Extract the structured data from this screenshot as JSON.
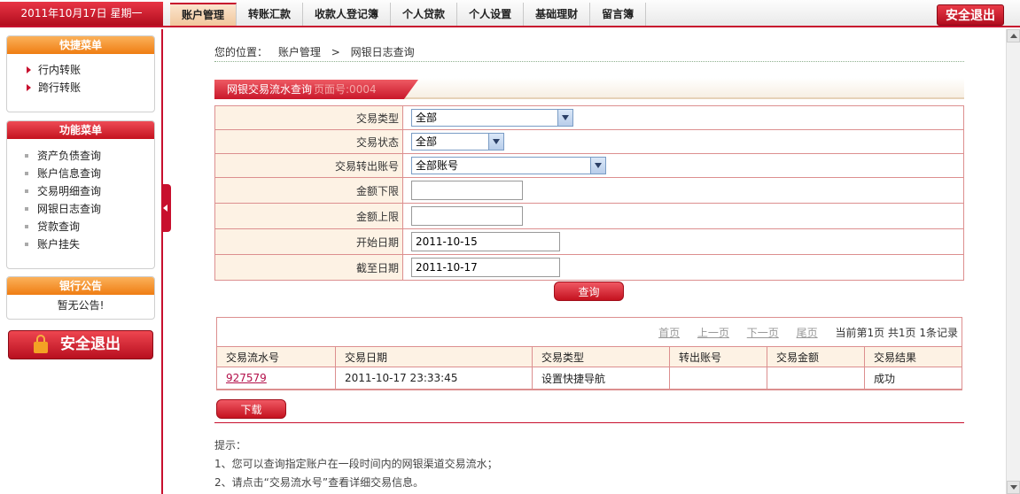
{
  "header": {
    "date": "2011年10月17日 星期一",
    "nav": [
      "账户管理",
      "转账汇款",
      "收款人登记簿",
      "个人贷款",
      "个人设置",
      "基础理财",
      "留言簿"
    ],
    "active_nav": "账户管理",
    "logout": "安全退出"
  },
  "sidebar": {
    "quick_menu": {
      "title": "快捷菜单",
      "items": [
        "行内转账",
        "跨行转账"
      ]
    },
    "func_menu": {
      "title": "功能菜单",
      "items": [
        "资产负债查询",
        "账户信息查询",
        "交易明细查询",
        "网银日志查询",
        "贷款查询",
        "账户挂失"
      ]
    },
    "notice": {
      "title": "银行公告",
      "text": "暂无公告!"
    },
    "logout": "安全退出",
    "lock_text": "LOCK"
  },
  "breadcrumb": {
    "prefix": "您的位置：",
    "level1": "账户管理",
    "sep": ">",
    "level2": "网银日志查询"
  },
  "section": {
    "title": "网银交易流水查询",
    "page_no": "页面号:0004"
  },
  "form": {
    "type_label": "交易类型",
    "type_value": "全部",
    "status_label": "交易状态",
    "status_value": "全部",
    "account_label": "交易转出账号",
    "account_value": "全部账号",
    "min_label": "金额下限",
    "min_value": "",
    "max_label": "金额上限",
    "max_value": "",
    "start_label": "开始日期",
    "start_value": "2011-10-15",
    "end_label": "截至日期",
    "end_value": "2011-10-17",
    "query_button": "查询"
  },
  "pager": {
    "first": "首页",
    "prev": "上一页",
    "next": "下一页",
    "last": "尾页",
    "info": "当前第1页 共1页 1条记录"
  },
  "results": {
    "columns": [
      "交易流水号",
      "交易日期",
      "交易类型",
      "转出账号",
      "交易金额",
      "交易结果"
    ],
    "rows": [
      {
        "serial": "927579",
        "date": "2011-10-17 23:33:45",
        "type": "设置快捷导航",
        "account": "",
        "amount": "",
        "result": "成功"
      }
    ]
  },
  "download_button": "下载",
  "tips": {
    "title": "提示：",
    "line1": "1、您可以查询指定账户在一段时间内的网银渠道交易流水；",
    "line2": "2、请点击“交易流水号”查看详细交易信息。"
  }
}
